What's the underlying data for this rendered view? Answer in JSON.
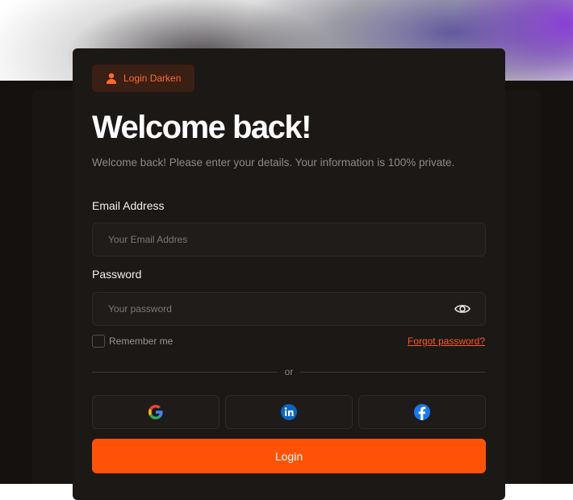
{
  "badge": {
    "label": "Login Darken",
    "icon": "user-icon"
  },
  "title": "Welcome back!",
  "subtitle": "Welcome back! Please enter your details. Your information is 100% private.",
  "email": {
    "label": "Email Address",
    "placeholder": "Your Email Addres",
    "value": ""
  },
  "password": {
    "label": "Password",
    "placeholder": "Your password",
    "value": "",
    "toggle_icon": "eye-icon"
  },
  "remember": {
    "label": "Remember me",
    "checked": false
  },
  "forgot_label": "Forgot password?",
  "divider_text": "or",
  "social": [
    {
      "name": "Google",
      "icon": "google-icon"
    },
    {
      "name": "LinkedIn",
      "icon": "linkedin-icon"
    },
    {
      "name": "Facebook",
      "icon": "facebook-icon"
    }
  ],
  "login_label": "Login",
  "colors": {
    "accent": "#ff5206",
    "background": "#14110f",
    "card": "#1b1816",
    "input_bg": "#1f1c1a",
    "badge_bg": "#3a1f15",
    "linkedin": "#0a66c2",
    "facebook": "#1877f2"
  }
}
